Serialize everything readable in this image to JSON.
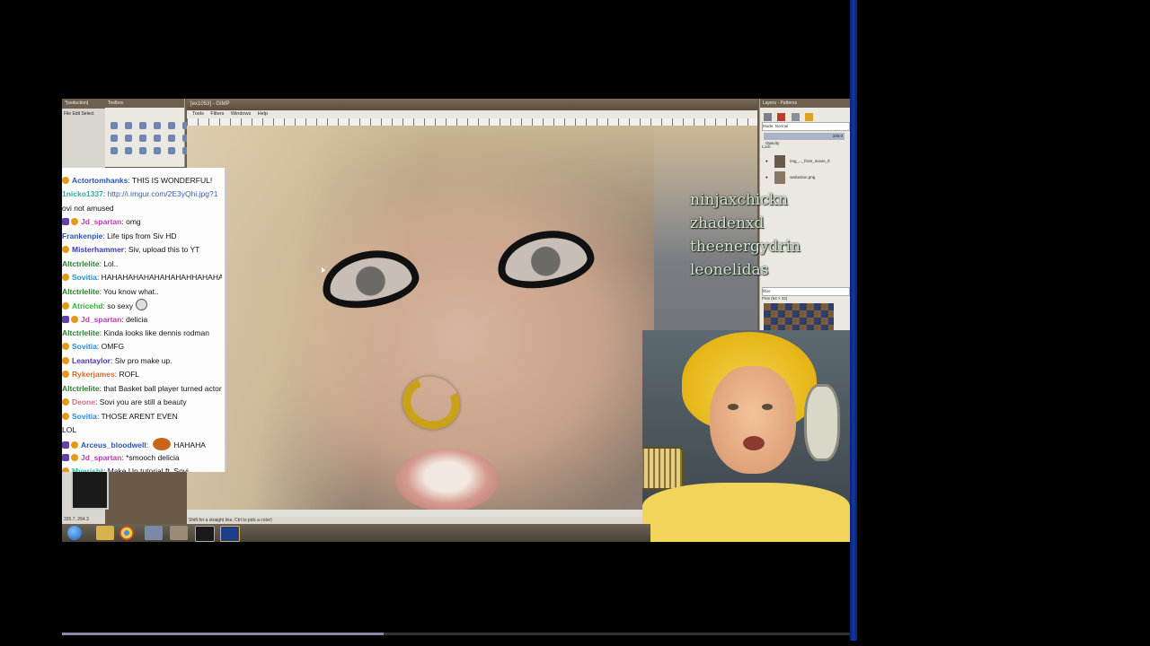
{
  "gimp": {
    "image_title": "[ex1053] - GIMP",
    "left_window_title": "*[seduction]",
    "toolbox_title": "Toolbox",
    "left_menu": [
      "File",
      "Edit",
      "Select",
      "View"
    ],
    "menu": [
      "Tools",
      "Filters",
      "Windows",
      "Help"
    ],
    "status_text": "Shift for a straight line, Ctrl to pick a color)",
    "coords": "335.7, 264.3"
  },
  "layers_dock": {
    "title": "Layers - Patterns",
    "mode_label": "Mode: Normal",
    "opacity_label": "Opacity",
    "opacity_value": "100.0",
    "lock_label": "Lock:",
    "layers": [
      {
        "name": "img_..._from_movie_tl"
      },
      {
        "name": "seduction.png"
      }
    ],
    "filter_label": "filter",
    "pattern_label": "Pine (64 × 32)"
  },
  "overlay_names": [
    "ninjaxchickn",
    "zhadenxd",
    "theenergydrin",
    "leonelidas"
  ],
  "chat": [
    {
      "user": "Actortomhanks",
      "color": "#2a55b8",
      "text": "THIS IS WONDERFUL!",
      "badges": [
        "sub"
      ]
    },
    {
      "user": "1nicko1337",
      "color": "#3aa9a0",
      "text": "http://i.imgur.com/2E3yQhi.jpg?1",
      "link": true,
      "badges": []
    },
    {
      "user": "",
      "color": "#111",
      "text": "ovi not amused",
      "badges": []
    },
    {
      "user": "Jd_spartan",
      "color": "#c239b3",
      "text": "omg",
      "badges": [
        "mod",
        "sub"
      ]
    },
    {
      "user": "Frankenpie",
      "color": "#2a55b8",
      "text": "Life tips from Siv HD",
      "badges": []
    },
    {
      "user": "Misterhammer",
      "color": "#3a3ab8",
      "text": "Siv, upload this to YT",
      "badges": [
        "sub"
      ]
    },
    {
      "user": "Altctrlelite",
      "color": "#2e7d32",
      "text": "Lol..",
      "badges": []
    },
    {
      "user": "Sovitia",
      "color": "#2a8cd4",
      "text": "HAHAHAHAHAHAHAHAHHAHAHAH",
      "badges": [
        "sub"
      ]
    },
    {
      "user": "Altctrlelite",
      "color": "#2e7d32",
      "text": "You know what..",
      "badges": []
    },
    {
      "user": "Atricehd",
      "color": "#2ab82a",
      "text": "so sexy",
      "badges": [
        "sub"
      ],
      "emote": true
    },
    {
      "user": "Jd_spartan",
      "color": "#c239b3",
      "text": "delicia",
      "badges": [
        "mod",
        "sub"
      ]
    },
    {
      "user": "Altctrlelite",
      "color": "#2e7d32",
      "text": "Kinda looks like dennis rodman",
      "badges": []
    },
    {
      "user": "Sovitia",
      "color": "#2a8cd4",
      "text": "OMFG",
      "badges": [
        "sub"
      ]
    },
    {
      "user": "Leantaylor",
      "color": "#4b3ab8",
      "text": "Siv pro make up.",
      "badges": [
        "sub"
      ]
    },
    {
      "user": "Rykerjames",
      "color": "#d46a2a",
      "text": "ROFL",
      "badges": [
        "sub"
      ]
    },
    {
      "user": "Altctrlelite",
      "color": "#2e7d32",
      "text": "that Basket ball player turned actor",
      "badges": []
    },
    {
      "user": "Deone",
      "color": "#d46a8a",
      "text": "Sovi you are still a beauty",
      "badges": [
        "sub"
      ]
    },
    {
      "user": "Sovitia",
      "color": "#2a8cd4",
      "text": "THOSE ARENT EVEN",
      "badges": [
        "sub"
      ]
    },
    {
      "user": "",
      "color": "#111",
      "text": "LOL",
      "badges": []
    },
    {
      "user": "Arceus_bloodwell",
      "color": "#2a55b8",
      "text": "HAHAHA",
      "badges": [
        "mod",
        "sub"
      ],
      "emote_big": true
    },
    {
      "user": "Jd_spartan",
      "color": "#c239b3",
      "text": "*smooch delicia",
      "badges": [
        "mod",
        "sub"
      ]
    },
    {
      "user": "Myerisht",
      "color": "#2ab8a0",
      "text": "Make Up tutorial ft. Sovi",
      "badges": [
        "sub"
      ]
    }
  ],
  "video": {
    "progress": 0.408
  }
}
